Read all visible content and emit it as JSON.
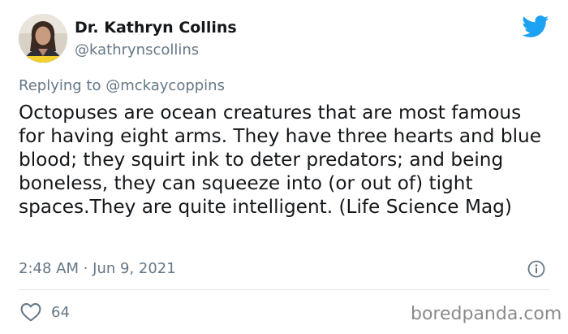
{
  "tweet": {
    "author": {
      "name": "Dr. Kathryn Collins",
      "handle": "@kathrynscollins"
    },
    "reply_prefix": "Replying to ",
    "reply_handle": "@mckaycoppins",
    "text": "Octopuses are ocean creatures that are most famous for having eight arms. They have three hearts and blue blood; they squirt ink to deter predators; and being boneless, they can squeeze into (or out of) tight spaces.They are quite intelligent. (Life Science Mag)",
    "timestamp": "2:48 AM · Jun 9, 2021",
    "likes": "64"
  },
  "icons": {
    "brand": "twitter-bird-icon",
    "info": "info-icon",
    "like": "heart-icon"
  },
  "colors": {
    "twitter_blue": "#1da1f2",
    "secondary_text": "#657786",
    "primary_text": "#14171a",
    "divider": "#e1e8ed"
  },
  "watermark": "boredpanda.com"
}
